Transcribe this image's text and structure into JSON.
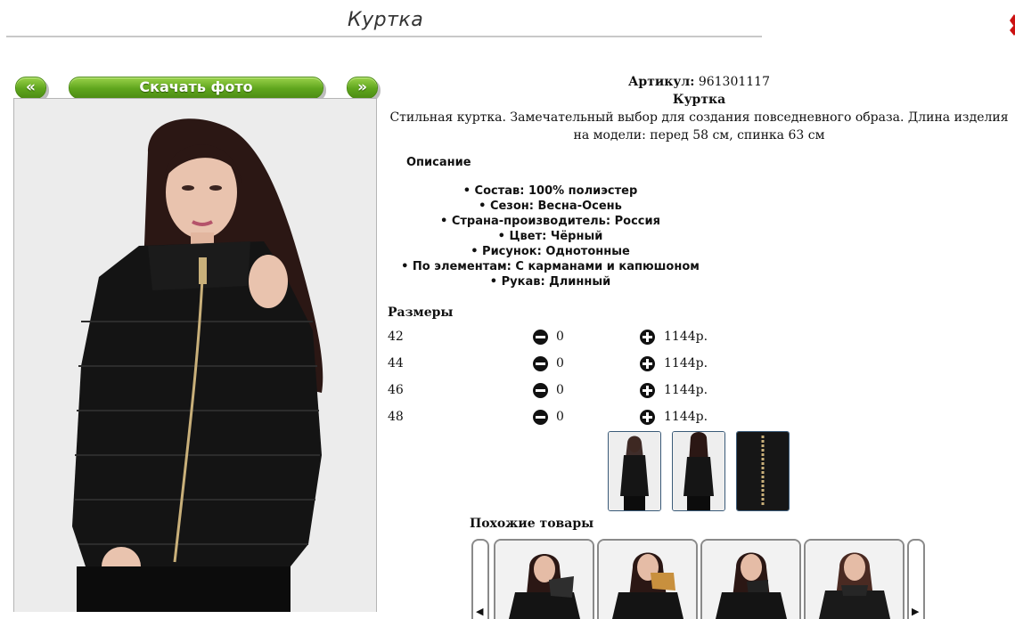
{
  "page": {
    "title": "Куртка"
  },
  "gallery": {
    "prev_label": "«",
    "next_label": "»",
    "download_label": "Скачать фото"
  },
  "product": {
    "article_label": "Артикул:",
    "article_value": "961301117",
    "name": "Куртка",
    "description": "Стильная куртка. Замечательный выбор для создания повседневного образа. Длина изделия на модели: перед 58 см, спинка 63 см"
  },
  "details": {
    "heading": "Описание",
    "attributes": [
      "Состав: 100% полиэстер",
      "Сезон: Весна-Осень",
      "Страна-производитель: Россия",
      "Цвет: Чёрный",
      "Рисунок: Однотонные",
      "По элементам: С карманами и капюшоном",
      "Рукав: Длинный"
    ]
  },
  "sizes": {
    "heading": "Размеры",
    "rows": [
      {
        "size": "42",
        "qty": "0",
        "price": "1144р."
      },
      {
        "size": "44",
        "qty": "0",
        "price": "1144р."
      },
      {
        "size": "46",
        "qty": "0",
        "price": "1144р."
      },
      {
        "size": "48",
        "qty": "0",
        "price": "1144р."
      }
    ]
  },
  "similar": {
    "heading": "Похожие товары"
  },
  "colors": {
    "button_green": "#5fa51d",
    "thumb_border": "#3a5a78",
    "corner_red": "#cc1111"
  }
}
